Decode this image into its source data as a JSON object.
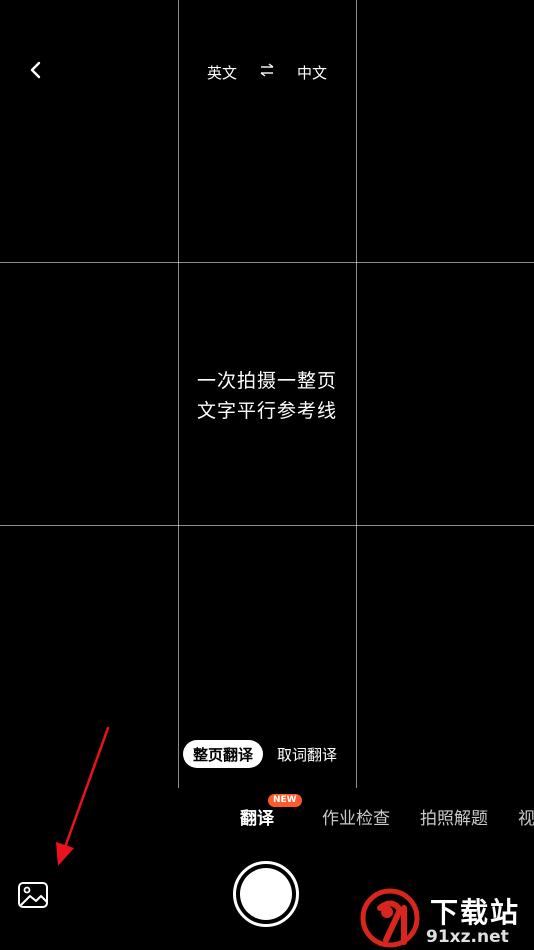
{
  "header": {
    "source_lang": "英文",
    "target_lang": "中文"
  },
  "viewfinder": {
    "hint_line1": "一次拍摄一整页",
    "hint_line2": "文字平行参考线"
  },
  "modes": [
    {
      "label": "整页翻译",
      "selected": true
    },
    {
      "label": "取词翻译",
      "selected": false
    }
  ],
  "tabs": [
    {
      "label": "翻译",
      "active": true,
      "badge": "NEW"
    },
    {
      "label": "作业检查",
      "active": false
    },
    {
      "label": "拍照解题",
      "active": false
    },
    {
      "label": "视",
      "active": false
    }
  ],
  "watermark": {
    "text": "下载站",
    "url": "91xz.net"
  },
  "colors": {
    "badge": "#ff5a2c",
    "annotation_arrow": "#e8141c",
    "watermark_red": "#d8261e"
  },
  "icons": {
    "back": "chevron-left-icon",
    "swap": "swap-arrows-icon",
    "gallery": "image-icon"
  }
}
